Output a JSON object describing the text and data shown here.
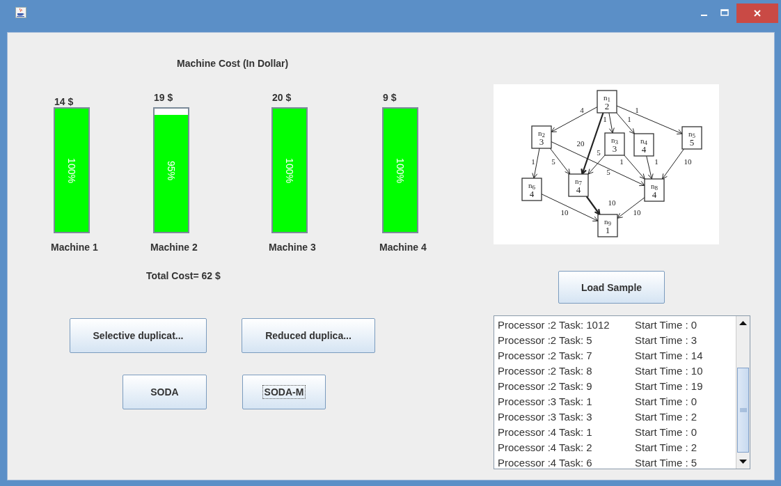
{
  "chart_title": "Machine Cost (In Dollar)",
  "machines": [
    {
      "cost": "14 $",
      "level": 1,
      "reading": "100%",
      "name": "Machine 1"
    },
    {
      "cost": "19 $",
      "level": 0.95,
      "reading": "95%",
      "name": "Machine 2"
    },
    {
      "cost": "20 $",
      "level": 1,
      "reading": "100%",
      "name": "Machine 3"
    },
    {
      "cost": "9 $",
      "level": 1,
      "reading": "100%",
      "name": "Machine 4"
    }
  ],
  "total_cost": "Total Cost= 62 $",
  "buttons": [
    {
      "label": "Selective duplicat...",
      "focused": false
    },
    {
      "label": "Reduced duplica...",
      "focused": false
    },
    {
      "label": "SODA",
      "focused": false
    },
    {
      "label": "SODA-M",
      "focused": true
    }
  ],
  "task_graph": {
    "nodes": [
      {
        "name": "n",
        "index": "1",
        "weight": "2"
      },
      {
        "name": "n",
        "index": "2",
        "weight": "3"
      },
      {
        "name": "n",
        "index": "3",
        "weight": "3"
      },
      {
        "name": "n",
        "index": "4",
        "weight": "4"
      },
      {
        "name": "n",
        "index": "5",
        "weight": "5"
      },
      {
        "name": "n",
        "index": "6",
        "weight": "4"
      },
      {
        "name": "n",
        "index": "7",
        "weight": "4"
      },
      {
        "name": "n",
        "index": "8",
        "weight": "4"
      },
      {
        "name": "n",
        "index": "9",
        "weight": "1"
      }
    ],
    "edges": [
      {
        "weight": "4",
        "bold": false
      },
      {
        "weight": "1",
        "bold": false
      },
      {
        "weight": "1",
        "bold": false
      },
      {
        "weight": "1",
        "bold": false
      },
      {
        "weight": "20",
        "bold": true
      },
      {
        "weight": "5",
        "bold": false
      },
      {
        "weight": "1",
        "bold": false
      },
      {
        "weight": "5",
        "bold": false
      },
      {
        "weight": "1",
        "bold": false
      },
      {
        "weight": "1",
        "bold": false
      },
      {
        "weight": "10",
        "bold": false
      },
      {
        "weight": "5",
        "bold": false
      },
      {
        "weight": "10",
        "bold": true
      },
      {
        "weight": "10",
        "bold": false
      },
      {
        "weight": "10",
        "bold": false
      }
    ]
  },
  "load_button": "Load Sample",
  "schedule": [
    {
      "task": "Processor :2 Task: 1012",
      "start": "Start Time : 0"
    },
    {
      "task": "Processor :2 Task: 5",
      "start": "Start Time : 3"
    },
    {
      "task": "Processor :2 Task: 7",
      "start": "Start Time : 14"
    },
    {
      "task": "Processor :2 Task: 8",
      "start": "Start Time : 10"
    },
    {
      "task": "Processor :2 Task: 9",
      "start": "Start Time : 19"
    },
    {
      "task": "Processor :3 Task: 1",
      "start": "Start Time : 0"
    },
    {
      "task": "Processor :3 Task: 3",
      "start": "Start Time : 2"
    },
    {
      "task": "Processor :4 Task: 1",
      "start": "Start Time : 0"
    },
    {
      "task": "Processor :4 Task: 2",
      "start": "Start Time : 2"
    },
    {
      "task": "Processor :4 Task: 6",
      "start": "Start Time : 5"
    }
  ]
}
